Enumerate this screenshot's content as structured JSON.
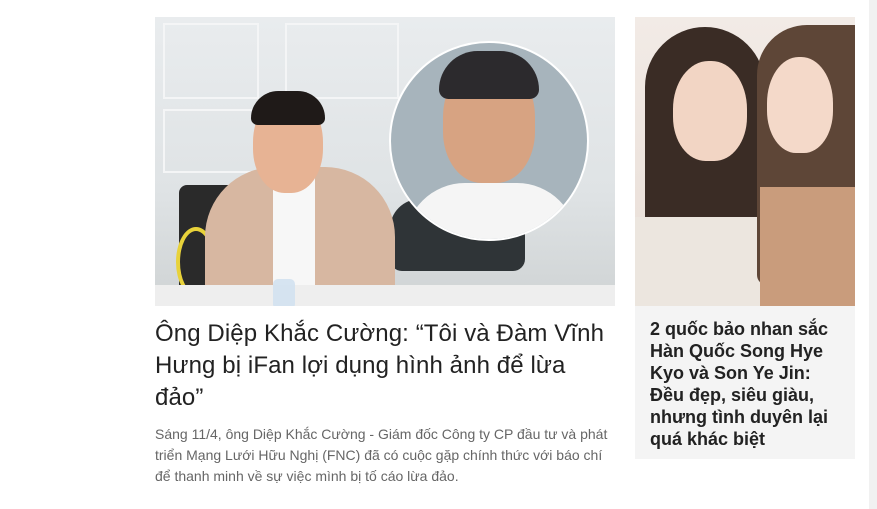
{
  "main_article": {
    "title": "Ông Diệp Khắc Cường: “Tôi và Đàm Vĩnh Hưng bị iFan lợi dụng hình ảnh để lừa đảo”",
    "summary": "Sáng 11/4, ông Diệp Khắc Cường - Giám đốc Công ty CP đầu tư và phát triển Mạng Lưới Hữu Nghị (FNC) đã có cuộc gặp chính thức với báo chí để thanh minh về sự việc mình bị tố cáo lừa đảo."
  },
  "side_article": {
    "title": "2 quốc bảo nhan sắc Hàn Quốc Song Hye Kyo và Son Ye Jin: Đều đẹp, siêu giàu, nhưng tình duyên lại quá khác biệt"
  },
  "colors": {
    "title": "#222222",
    "summary": "#666666",
    "side_card_background": "#f4f4f4"
  }
}
